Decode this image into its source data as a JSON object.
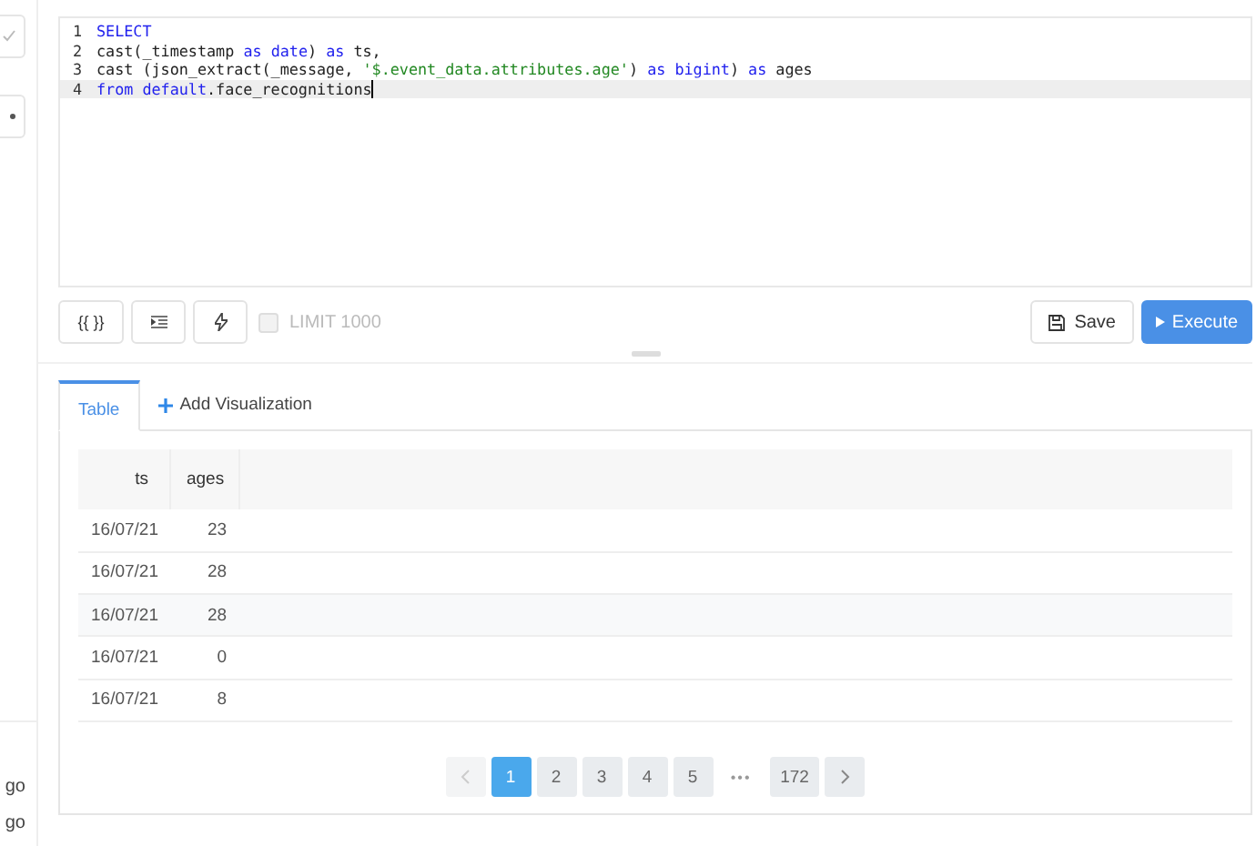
{
  "sidebar": {
    "items": [
      {
        "label": "go"
      },
      {
        "label": "go"
      }
    ]
  },
  "editor": {
    "lines": [
      {
        "number": "1",
        "active": false,
        "tokens": [
          {
            "kind": "keyword",
            "text": "SELECT"
          }
        ]
      },
      {
        "number": "2",
        "active": false,
        "tokens": [
          {
            "kind": "plain",
            "text": "cast(_timestamp "
          },
          {
            "kind": "keyword",
            "text": "as date"
          },
          {
            "kind": "plain",
            "text": ") "
          },
          {
            "kind": "keyword",
            "text": "as"
          },
          {
            "kind": "plain",
            "text": " ts,"
          }
        ]
      },
      {
        "number": "3",
        "active": false,
        "tokens": [
          {
            "kind": "plain",
            "text": "cast (json_extract(_message, "
          },
          {
            "kind": "string",
            "text": "'$.event_data.attributes.age'"
          },
          {
            "kind": "plain",
            "text": ") "
          },
          {
            "kind": "keyword",
            "text": "as bigint"
          },
          {
            "kind": "plain",
            "text": ") "
          },
          {
            "kind": "keyword",
            "text": "as"
          },
          {
            "kind": "plain",
            "text": " ages"
          }
        ]
      },
      {
        "number": "4",
        "active": true,
        "tokens": [
          {
            "kind": "keyword",
            "text": "from default"
          },
          {
            "kind": "plain",
            "text": ".face_recognitions"
          }
        ]
      }
    ]
  },
  "toolbar": {
    "params_button": "{{ }}",
    "limit": {
      "label": "LIMIT 1000",
      "checked": false,
      "disabled": true
    },
    "save": "Save",
    "execute": "Execute"
  },
  "tabs": [
    {
      "label": "Table",
      "selected": true
    },
    {
      "label": "Add Visualization",
      "selected": false
    }
  ],
  "table": {
    "columns": [
      "ts",
      "ages"
    ],
    "rows": [
      [
        "16/07/21",
        "23"
      ],
      [
        "16/07/21",
        "28"
      ],
      [
        "16/07/21",
        "28"
      ],
      [
        "16/07/21",
        "0"
      ],
      [
        "16/07/21",
        "8"
      ]
    ]
  },
  "pagination": {
    "pages": [
      {
        "label": "1",
        "selected": true
      },
      {
        "label": "2",
        "selected": false
      },
      {
        "label": "3",
        "selected": false
      },
      {
        "label": "4",
        "selected": false
      },
      {
        "label": "5",
        "selected": false
      },
      {
        "label": "•••",
        "kind": "ellipsis"
      },
      {
        "label": "172",
        "selected": false
      }
    ]
  }
}
